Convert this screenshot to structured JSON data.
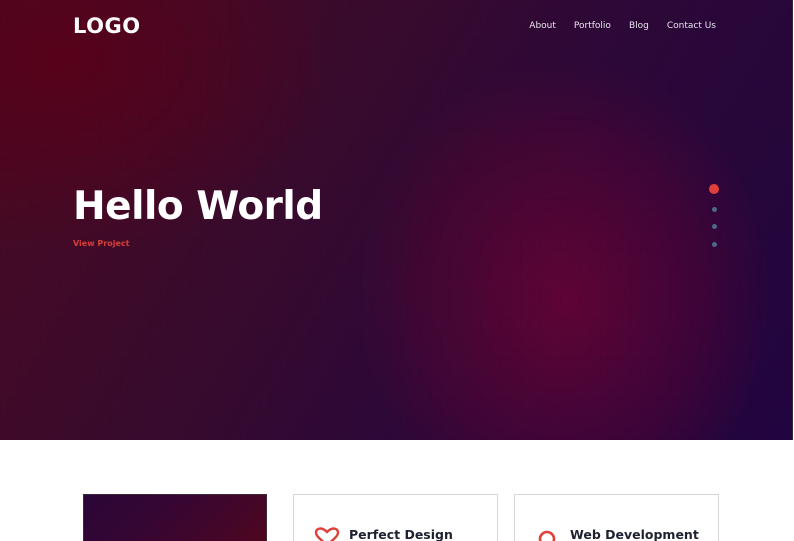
{
  "header": {
    "logo": "LOGO",
    "nav": [
      "About",
      "Portfolio",
      "Blog",
      "Contact Us"
    ]
  },
  "hero": {
    "title": "Hello World",
    "cta": "View Project",
    "slides": {
      "count": 4,
      "active": 1
    }
  },
  "features": [
    {
      "title": "Perfect Design",
      "icon": "heart-icon"
    },
    {
      "title": "Web Development",
      "icon": "circle-icon"
    }
  ],
  "colors": {
    "accent": "#e0403a",
    "hero_bg_dark": "#220440",
    "hero_bg_red": "#4a0a22",
    "dot_inactive": "#4e6a86"
  }
}
